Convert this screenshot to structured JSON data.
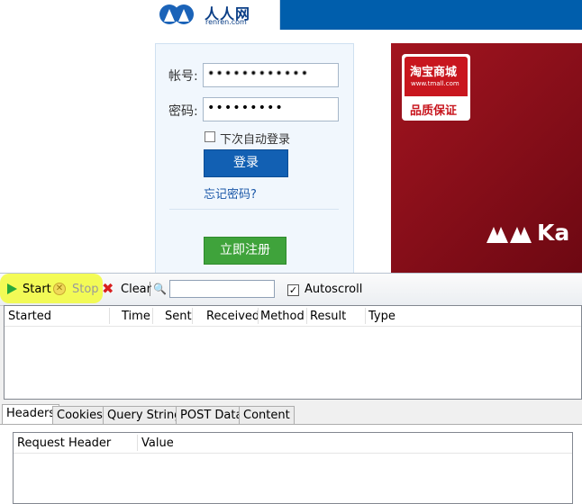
{
  "webpage": {
    "logo": {
      "chinese": "人人网",
      "domain": "renren.com"
    },
    "login": {
      "account_label": "帐号:",
      "account_value": "••••••••••••",
      "password_label": "密码:",
      "password_value": "•••••••••",
      "remember_label": "下次自动登录",
      "login_button": "登录",
      "forgot_link": "忘记密码?",
      "register_button": "立即注册"
    },
    "ad": {
      "brand": "淘宝商城",
      "url": "www.tmall.com",
      "quality": "品质保证",
      "kappa_text": "Ka"
    }
  },
  "tool": {
    "toolbar": {
      "start_label": "Start",
      "stop_label": "Stop",
      "clear_label": "Clear",
      "search_value": "",
      "autoscroll_label": "Autoscroll",
      "autoscroll_checked": true
    },
    "request_columns": [
      "Started",
      "Time",
      "Sent",
      "Received",
      "Method",
      "Result",
      "Type"
    ],
    "detail_tabs": [
      "Headers",
      "Cookies",
      "Query String",
      "POST Data",
      "Content"
    ],
    "active_tab": "Headers",
    "header_columns": [
      "Request Header",
      "Value"
    ]
  },
  "colors": {
    "renren_blue": "#005eac",
    "login_button": "#1260b3",
    "register_button": "#3fa33b",
    "highlight": "#f2fb3a"
  }
}
